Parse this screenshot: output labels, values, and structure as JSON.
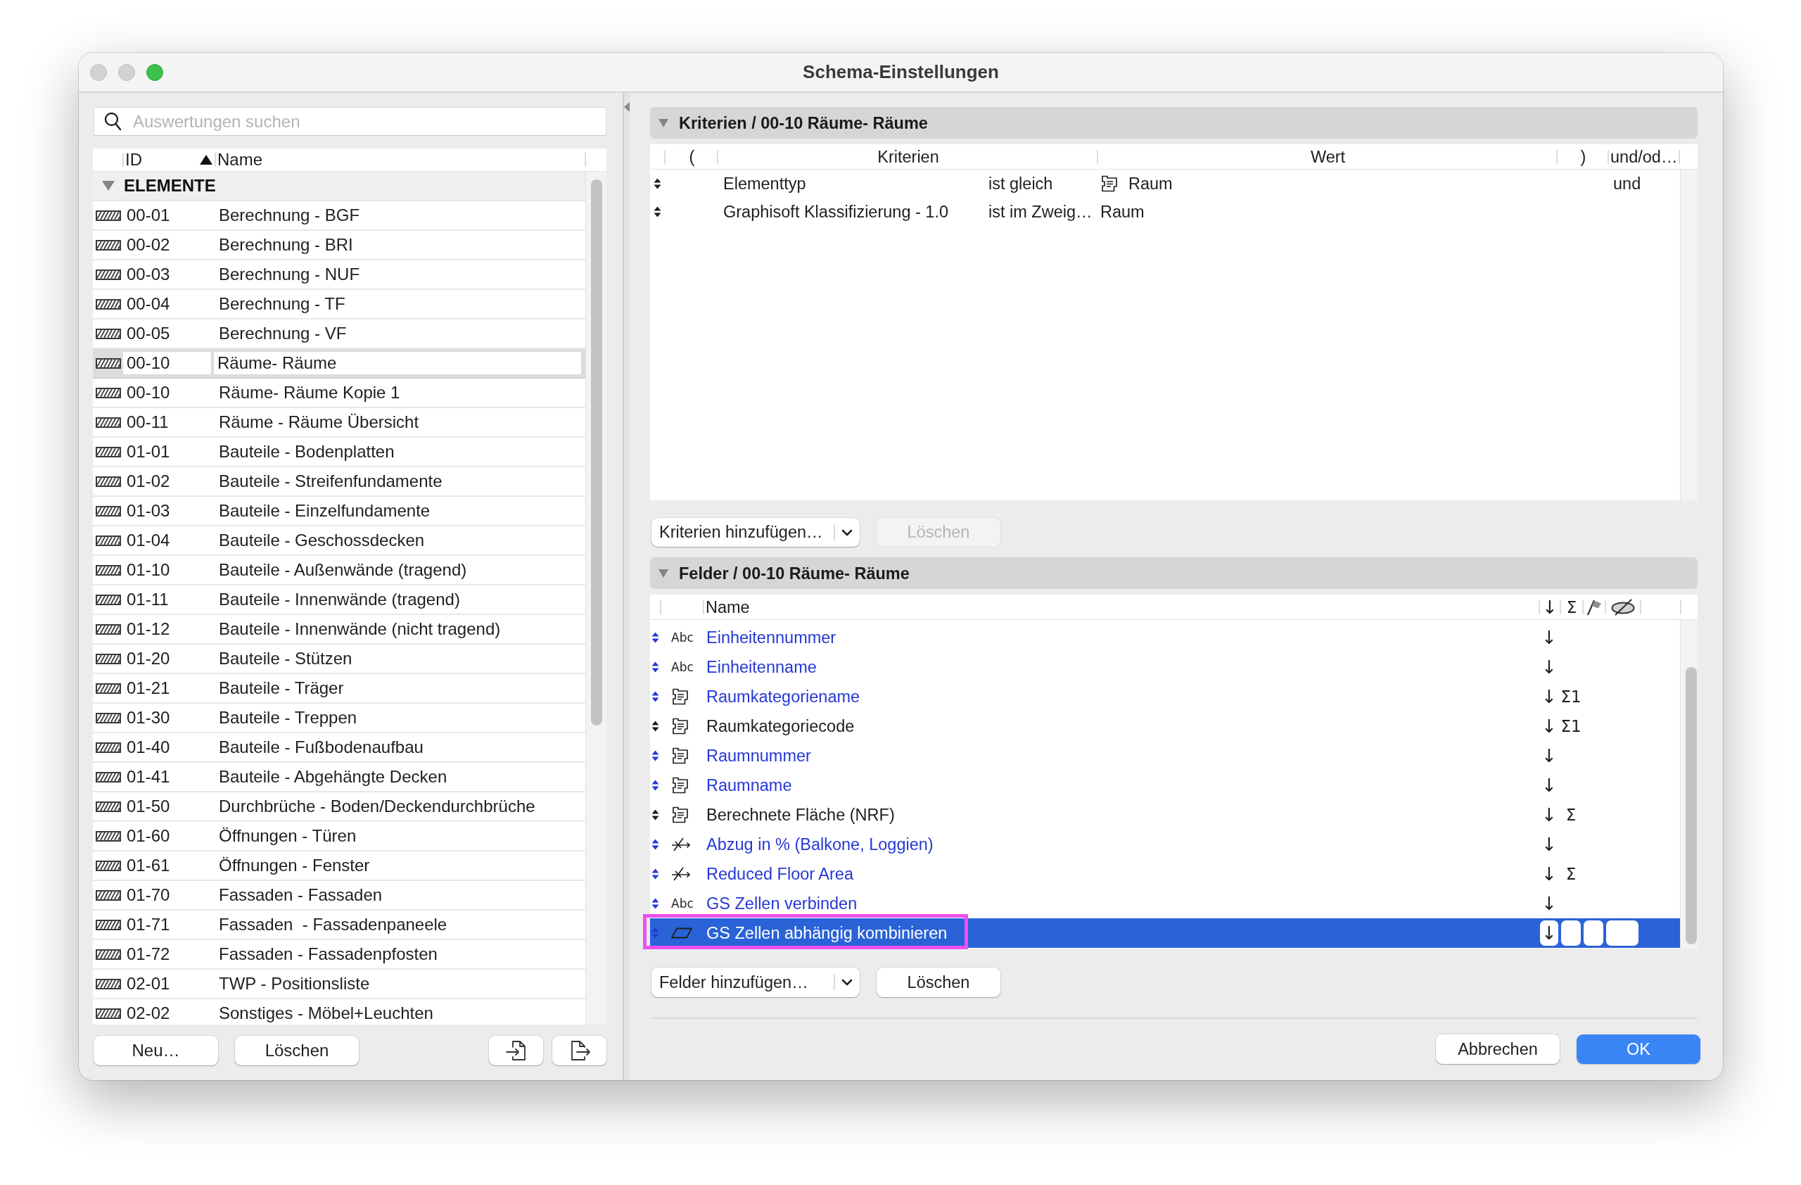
{
  "window": {
    "title": "Schema-Einstellungen",
    "controls": [
      {
        "kind": "close",
        "enabled": false
      },
      {
        "kind": "minimize",
        "enabled": false
      },
      {
        "kind": "zoom",
        "enabled": true
      }
    ]
  },
  "schedules": {
    "search": {
      "placeholder": "Auswertungen suchen"
    },
    "columns": [
      {
        "label": "ID",
        "sorted": true
      },
      {
        "label": "Name",
        "sorted": false
      }
    ],
    "groups": [
      {
        "label": "ELEMENTE",
        "expanded": true,
        "items": [
          {
            "id": "00-01",
            "name": "Berechnung - BGF",
            "selected": false
          },
          {
            "id": "00-02",
            "name": "Berechnung - BRI",
            "selected": false
          },
          {
            "id": "00-03",
            "name": "Berechnung - NUF",
            "selected": false
          },
          {
            "id": "00-04",
            "name": "Berechnung - TF",
            "selected": false
          },
          {
            "id": "00-05",
            "name": "Berechnung - VF",
            "selected": false
          },
          {
            "id": "00-10",
            "name": "Räume- Räume",
            "selected": true
          },
          {
            "id": "00-10",
            "name": "Räume- Räume Kopie 1",
            "selected": false
          },
          {
            "id": "00-11",
            "name": "Räume - Räume Übersicht",
            "selected": false
          },
          {
            "id": "01-01",
            "name": "Bauteile - Bodenplatten",
            "selected": false
          },
          {
            "id": "01-02",
            "name": "Bauteile - Streifenfundamente",
            "selected": false
          },
          {
            "id": "01-03",
            "name": "Bauteile - Einzelfundamente",
            "selected": false
          },
          {
            "id": "01-04",
            "name": "Bauteile - Geschossdecken",
            "selected": false
          },
          {
            "id": "01-10",
            "name": "Bauteile - Außenwände (tragend)",
            "selected": false
          },
          {
            "id": "01-11",
            "name": "Bauteile - Innenwände (tragend)",
            "selected": false
          },
          {
            "id": "01-12",
            "name": "Bauteile - Innenwände (nicht tragend)",
            "selected": false
          },
          {
            "id": "01-20",
            "name": "Bauteile - Stützen",
            "selected": false
          },
          {
            "id": "01-21",
            "name": "Bauteile - Träger",
            "selected": false
          },
          {
            "id": "01-30",
            "name": "Bauteile - Treppen",
            "selected": false
          },
          {
            "id": "01-40",
            "name": "Bauteile - Fußbodenaufbau",
            "selected": false
          },
          {
            "id": "01-41",
            "name": "Bauteile - Abgehängte Decken",
            "selected": false
          },
          {
            "id": "01-50",
            "name": "Durchbrüche - Boden/Deckendurchbrüche",
            "selected": false
          },
          {
            "id": "01-60",
            "name": "Öffnungen - Türen",
            "selected": false
          },
          {
            "id": "01-61",
            "name": "Öffnungen - Fenster",
            "selected": false
          },
          {
            "id": "01-70",
            "name": "Fassaden - Fassaden",
            "selected": false
          },
          {
            "id": "01-71",
            "name": "Fassaden  - Fassadenpaneele",
            "selected": false
          },
          {
            "id": "01-72",
            "name": "Fassaden - Fassadenpfosten",
            "selected": false
          },
          {
            "id": "02-01",
            "name": "TWP - Positionsliste",
            "selected": false
          },
          {
            "id": "02-02",
            "name": "Sonstiges - Möbel+Leuchten",
            "selected": false
          }
        ]
      }
    ],
    "buttons": [
      {
        "label": "Neu…"
      },
      {
        "label": "Löschen"
      }
    ],
    "icon_buttons": [
      {
        "kind": "import"
      },
      {
        "kind": "export"
      }
    ]
  },
  "criteria": {
    "title": "Kriterien / 00-10 Räume- Räume",
    "expanded": true,
    "columns": {
      "open": "(",
      "criteria": "Kriterien",
      "value": "Wert",
      "close": ")",
      "logic": "und/od…"
    },
    "rows": [
      {
        "criterion": "Elementtyp",
        "operator": "ist gleich",
        "value": "Raum",
        "value_icon": true,
        "logic": "und"
      },
      {
        "criterion": "Graphisoft Klassifizierung - 1.0",
        "operator": "ist im Zweig…",
        "value": "Raum",
        "value_icon": false
      }
    ],
    "add_button": {
      "label": "Kriterien hinzufügen…"
    },
    "delete_button": {
      "label": "Löschen",
      "disabled": true
    }
  },
  "fields": {
    "title": "Felder / 00-10 Räume- Räume",
    "expanded": true,
    "columns": {
      "name": "Name",
      "sort": "↓",
      "total": "Σ"
    },
    "rows": [
      {
        "kind": "text",
        "badge": "Abc",
        "name": "Einheitennummer",
        "color": "#2438d6",
        "sort": "↓",
        "selected": false,
        "highlighted": false
      },
      {
        "kind": "text",
        "badge": "Abc",
        "name": "Einheitenname",
        "color": "#2438d6",
        "sort": "↓",
        "selected": false,
        "highlighted": false
      },
      {
        "kind": "zone",
        "name": "Raumkategoriename",
        "color": "#2438d6",
        "sort": "↓",
        "total": "Σ1",
        "selected": false,
        "highlighted": false
      },
      {
        "kind": "zone",
        "name": "Raumkategoriecode",
        "color": "#1e1e1e",
        "sort": "↓",
        "total": "Σ1",
        "selected": false,
        "highlighted": false
      },
      {
        "kind": "zone",
        "name": "Raumnummer",
        "color": "#2438d6",
        "sort": "↓",
        "selected": false,
        "highlighted": false
      },
      {
        "kind": "zone",
        "name": "Raumname",
        "color": "#2438d6",
        "sort": "↓",
        "selected": false,
        "highlighted": false
      },
      {
        "kind": "zone",
        "name": "Berechnete Fläche (NRF)",
        "color": "#1e1e1e",
        "sort": "↓",
        "total": "Σ",
        "selected": false,
        "highlighted": false
      },
      {
        "kind": "expression",
        "name": "Abzug in % (Balkone, Loggien)",
        "color": "#2438d6",
        "sort": "↓",
        "selected": false,
        "highlighted": false
      },
      {
        "kind": "expression",
        "name": "Reduced Floor Area",
        "color": "#2438d6",
        "sort": "↓",
        "total": "Σ",
        "selected": false,
        "highlighted": false
      },
      {
        "kind": "text",
        "badge": "Abc",
        "name": "GS Zellen verbinden",
        "color": "#2438d6",
        "sort": "↓",
        "selected": false,
        "highlighted": false
      },
      {
        "kind": "polygon",
        "name": "GS Zellen abhängig kombinieren",
        "color": "#2438d6",
        "sort": "↓",
        "selected": true,
        "highlighted": true
      }
    ],
    "add_button": {
      "label": "Felder hinzufügen…"
    },
    "delete_button": {
      "label": "Löschen",
      "disabled": false
    }
  },
  "footer": {
    "buttons": [
      {
        "label": "Abbrechen",
        "default": false
      },
      {
        "label": "OK",
        "default": true
      }
    ]
  }
}
